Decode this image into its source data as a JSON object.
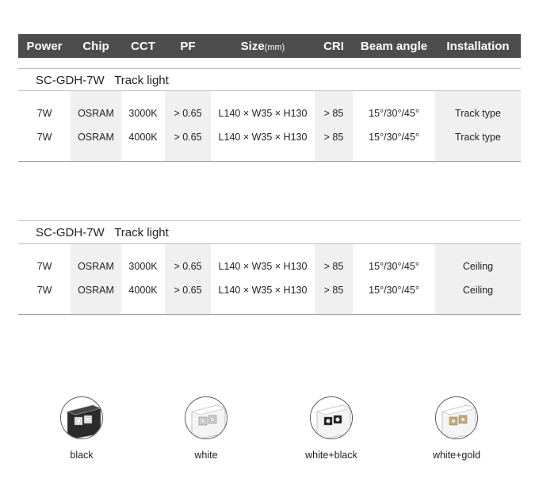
{
  "header": {
    "power": "Power",
    "chip": "Chip",
    "cct": "CCT",
    "pf": "PF",
    "size": "Size",
    "size_unit": "(mm)",
    "cri": "CRI",
    "beam": "Beam angle",
    "installation": "Installation"
  },
  "sections": [
    {
      "model": "SC-GDH-7W",
      "type": "Track light",
      "rows": [
        {
          "power": "7W",
          "chip": "OSRAM",
          "cct": "3000K",
          "pf": "> 0.65",
          "size": "L140 × W35 × H130",
          "cri": "> 85",
          "beam": "15°/30°/45°",
          "installation": "Track type"
        },
        {
          "power": "7W",
          "chip": "OSRAM",
          "cct": "4000K",
          "pf": "> 0.65",
          "size": "L140 × W35 × H130",
          "cri": "> 85",
          "beam": "15°/30°/45°",
          "installation": "Track type"
        }
      ]
    },
    {
      "model": "SC-GDH-7W",
      "type": "Track light",
      "rows": [
        {
          "power": "7W",
          "chip": "OSRAM",
          "cct": "3000K",
          "pf": "> 0.65",
          "size": "L140 × W35 × H130",
          "cri": "> 85",
          "beam": "15°/30°/45°",
          "installation": "Ceiling"
        },
        {
          "power": "7W",
          "chip": "OSRAM",
          "cct": "4000K",
          "pf": "> 0.65",
          "size": "L140 × W35 × H130",
          "cri": "> 85",
          "beam": "15°/30°/45°",
          "installation": "Ceiling"
        }
      ]
    }
  ],
  "colors": [
    {
      "label": "black",
      "body": "#2b2b2b",
      "accent": "#e8e8e8"
    },
    {
      "label": "white",
      "body": "#f4f4f4",
      "accent": "#cfcfcf"
    },
    {
      "label": "white+black",
      "body": "#f4f4f4",
      "accent": "#1a1a1a"
    },
    {
      "label": "white+gold",
      "body": "#f4f4f4",
      "accent": "#c9a96a"
    }
  ]
}
